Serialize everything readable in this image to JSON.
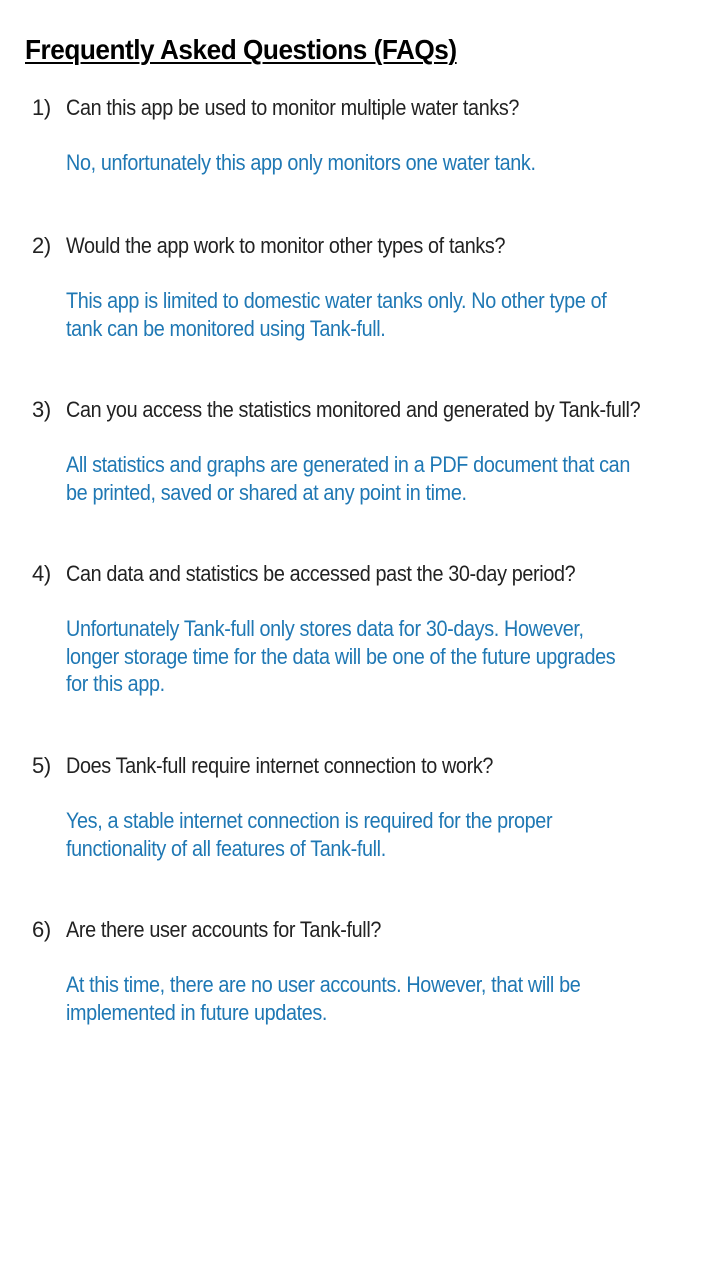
{
  "page": {
    "title": "Frequently Asked Questions (FAQs)"
  },
  "colors": {
    "question_text": "#222222",
    "answer_text": "#1f78b4",
    "background": "#ffffff"
  },
  "faqs": [
    {
      "number": "1)",
      "question": "Can this app be used to monitor multiple water tanks?",
      "answer_lines": [
        "No, unfortunately this app only monitors one water tank."
      ]
    },
    {
      "number": "2)",
      "question": "Would the app work to monitor other types of tanks?",
      "answer_lines": [
        "This app is limited to domestic water tanks only. No other type of",
        "tank can be monitored using Tank-full."
      ]
    },
    {
      "number": "3)",
      "question": "Can you access the statistics monitored and generated by Tank-full?",
      "answer_lines": [
        "All statistics and graphs are generated in a PDF document that can",
        "be printed, saved or shared at any point in time."
      ]
    },
    {
      "number": "4)",
      "question": "Can data and statistics be accessed past the 30-day period?",
      "answer_lines": [
        "Unfortunately Tank-full only stores data for 30-days. However,",
        "longer storage time for the data will be one of the future upgrades",
        "for this app."
      ]
    },
    {
      "number": "5)",
      "question": "Does Tank-full require internet connection to work?",
      "answer_lines": [
        "Yes, a stable internet connection is required for the proper",
        "functionality of all features of Tank-full."
      ]
    },
    {
      "number": "6)",
      "question": "Are there user accounts for Tank-full?",
      "answer_lines": [
        "At this time, there are no user accounts. However, that will be",
        "implemented in future updates."
      ]
    }
  ]
}
